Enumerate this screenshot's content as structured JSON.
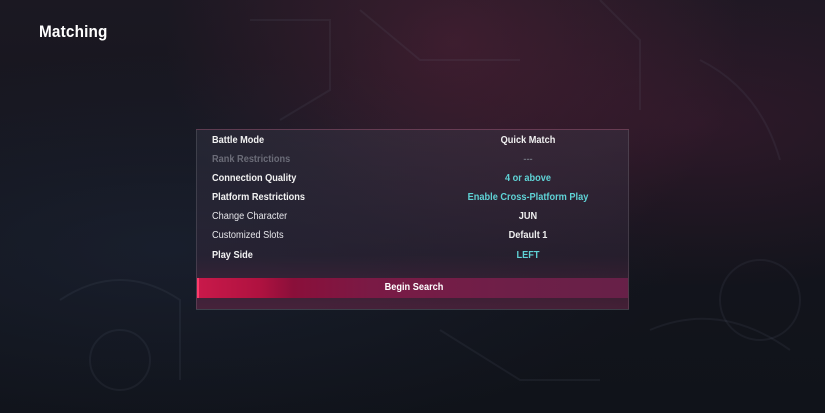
{
  "page": {
    "title": "Matching"
  },
  "settings": {
    "rows": [
      {
        "label": "Battle Mode",
        "value": "Quick Match"
      },
      {
        "label": "Rank Restrictions",
        "value": "---"
      },
      {
        "label": "Connection Quality",
        "value": "4 or above"
      },
      {
        "label": "Platform Restrictions",
        "value": "Enable Cross-Platform Play"
      },
      {
        "label": "Change Character",
        "value": "JUN"
      },
      {
        "label": "Customized Slots",
        "value": "Default 1"
      },
      {
        "label": "Play Side",
        "value": "LEFT"
      }
    ]
  },
  "actions": {
    "begin_search_label": "Begin Search"
  },
  "colors": {
    "accent": "#c8194a",
    "highlight_value": "#5fd3d6",
    "disabled_text": "#6b6c78"
  }
}
